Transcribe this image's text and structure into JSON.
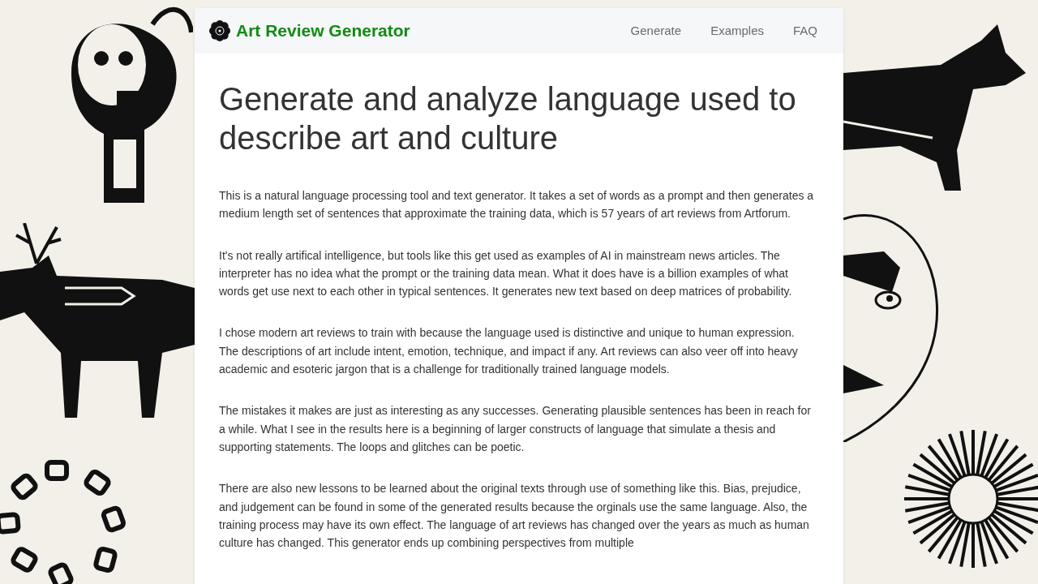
{
  "site": {
    "title": "Art Review Generator"
  },
  "nav": [
    {
      "label": "Generate"
    },
    {
      "label": "Examples"
    },
    {
      "label": "FAQ"
    }
  ],
  "heading": "Generate and analyze language used to describe art and culture",
  "paragraphs": [
    "This is a natural language processing tool and text generator. It takes a set of words as a prompt and then generates a medium length set of sentences that approximate the training data, which is 57 years of art reviews from Artforum.",
    "It's not really artifical intelligence, but tools like this get used as examples of AI in mainstream news articles. The interpreter has no idea what the prompt or the training data mean. What it does have is a billion examples of what words get use next to each other in typical sentences. It generates new text based on deep matrices of probability.",
    "I chose modern art reviews to train with because the language used is distinctive and unique to human expression. The descriptions of art include intent, emotion, technique, and impact if any. Art reviews can also veer off into heavy academic and esoteric jargon that is a challenge for traditionally trained language models.",
    "The mistakes it makes are just as interesting as any successes. Generating plausible sentences has been in reach for a while. What I see in the results here is a beginning of larger constructs of language that simulate a thesis and supporting statements. The loops and glitches can be poetic.",
    "There are also new lessons to be learned about the original texts through use of something like this. Bias, prejudice, and judgement can be found in some of the generated results because the orginals use the same language. Also, the training process may have its own effect. The language of art reviews has changed over the years as much as human culture has changed. This generator ends up combining perspectives from multiple"
  ]
}
